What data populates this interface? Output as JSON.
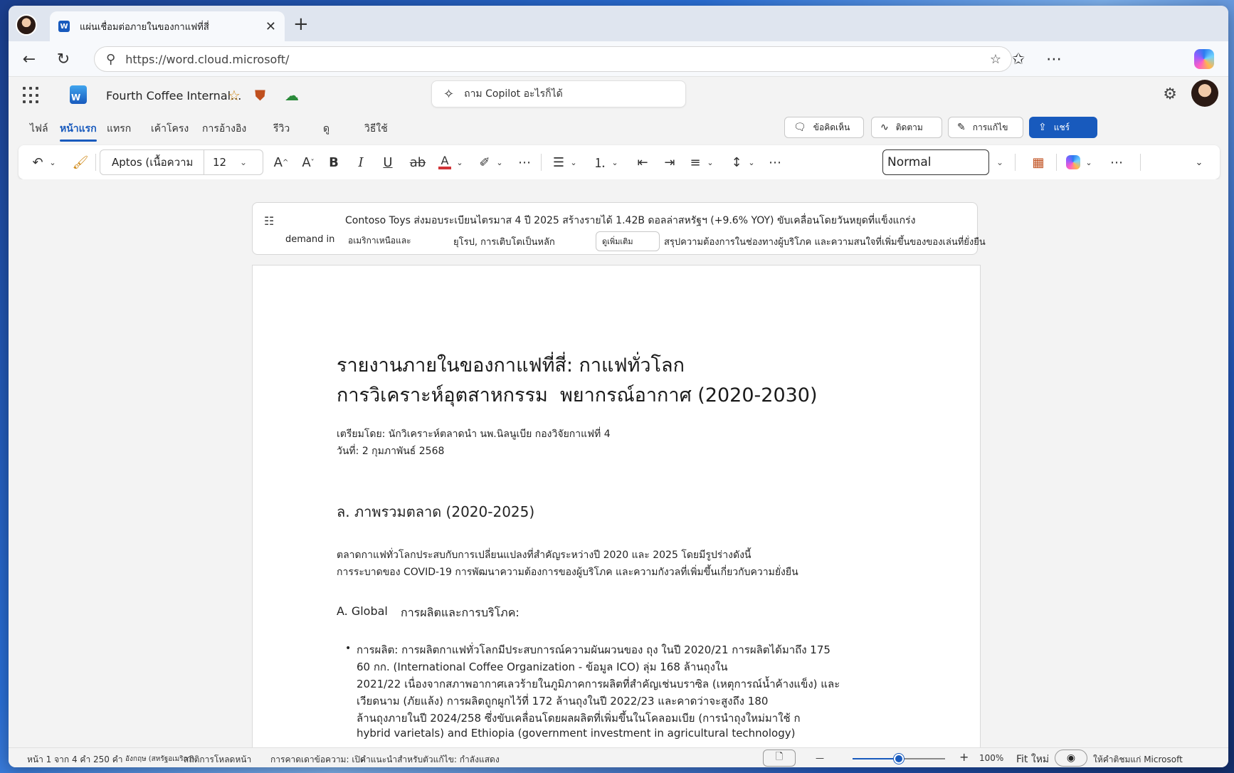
{
  "browser": {
    "tab_title": "แผ่นเชื่อมต่อภายในของกาแฟที่สี่",
    "tab_icon_letter": "W",
    "url": "https://word.cloud.microsoft/",
    "new_tab_glyph": "+",
    "close_glyph": "✕"
  },
  "word": {
    "app_letter": "W",
    "doc_title": "Fourth Coffee Internal...",
    "search_placeholder": "ถาม Copilot อะไรก็ได้"
  },
  "ribbon": {
    "tabs": [
      "ไฟล์",
      "หน้าแรก",
      "แทรก",
      "เค้าโครง",
      "การอ้างอิง",
      "รีวิว",
      "ดู",
      "วิธีใช้"
    ],
    "active_tab": "หน้าแรก",
    "comments": "ข้อคิดเห็น",
    "catchup": "ติดตาม",
    "editing": "การแก้ไข",
    "share": "แชร์"
  },
  "toolbar": {
    "font_name": "Aptos (เนื้อความ",
    "font_size": "12",
    "style": "Normal"
  },
  "summary": {
    "line1": "Contoso Toys ส่งมอบระเบียนไตรมาส 4 ปี 2025 สร้างรายได้ 1.42B ดอลล่าสหรัฐฯ (+9.6% YOY) ขับเคลื่อนโดยวันหยุดที่แข็งแกร่ง",
    "line2a": "demand in",
    "line2b": "อเมริกาเหนือและ",
    "line2c": "ยุโรป, การเติบโตเป็นหลัก",
    "more_button": "ดูเพิ่มเติม",
    "line2d": "สรุปความต้องการในช่องทางผู้บริโภค และความสนใจที่เพิ่มขึ้นของของเล่นที่ยั่งยืน"
  },
  "document": {
    "title_line1": "รายงานภายในของกาแฟที่สี่: กาแฟทั่วโลก",
    "title_line2a": "การวิเคราะห์อุตสาหกรรม",
    "title_line2b": "พยากรณ์อากาศ (2020-2030)",
    "prepared_by": "เตรียมโดย: นักวิเคราะห์ตลาดนำ นพ.นิลนูเบีย กองวิจัยกาแฟที่ 4",
    "date": "วันที่: 2 กุมภาพันธ์ 2568",
    "section_heading": "ล. ภาพรวมตลาด (2020-2025)",
    "para_line1": "ตลาดกาแฟทั่วโลกประสบกับการเปลี่ยนแปลงที่สำคัญระหว่างปี 2020 และ 2025 โดยมีรูปร่างดังนี้",
    "para_line2": "การระบาดของ COVID-19 การพัฒนาความต้องการของผู้บริโภค และความกังวลที่เพิ่มขึ้นเกี่ยวกับความยั่งยืน",
    "sub_heading_a": "A. Global",
    "sub_heading_b": "การผลิตและการบริโภค:",
    "bullet_glyph": "•",
    "bullet_lines": [
      "การผลิต: การผลิตกาแฟทั่วโลกมีประสบการณ์ความผันผวนของ ถุง                     ในปี 2020/21 การผลิตได้มาถึง 175",
      "60 กก. (International Coffee Organization -                          ข้อมูล ICO) ลุ่ม 168 ล้านถุงใน",
      "2021/22  เนื่องจากสภาพอากาศเลวร้ายในภูมิภาคการผลิตที่สำคัญเช่นบราซิล (เหตุการณ์น้ำค้างแข็ง) และ",
      "เวียดนาม (ภัยแล้ง) การผลิตถูกผูกไว้ที่ 172 ล้านถุงในปี 2022/23 และคาดว่าจะสูงถึง 180",
      "ล้านถุงภายในปี  2024/258  ซึ่งขับเคลื่อนโดยผลผลิตที่เพิ่มขึ้นในโคลอมเบีย  (การนำถุงใหม่มาใช้ ก",
      "hybrid varietals) and Ethiopia (government investment in agricultural technology)"
    ]
  },
  "status": {
    "page_info": "หน้า 1 จาก 4 คำ 250 คำ",
    "language": "อังกฤษ (สหรัฐอเมริกา)",
    "stats": "สถิติการโหลดหน้า",
    "predictions": "การคาดเดาข้อความ: เปิด",
    "suggestions": "คำแนะนำสำหรับตัวแก้ไข: กำลังแสดง",
    "zoom_minus": "—",
    "zoom_plus": "+",
    "zoom_level": 100,
    "zoom_label": "100%",
    "fit": "Fit ใหม่",
    "feedback": "ให้คำติชมแก่ Microsoft"
  },
  "colors": {
    "accent": "#185abd",
    "font_color_bar": "#d13438"
  }
}
